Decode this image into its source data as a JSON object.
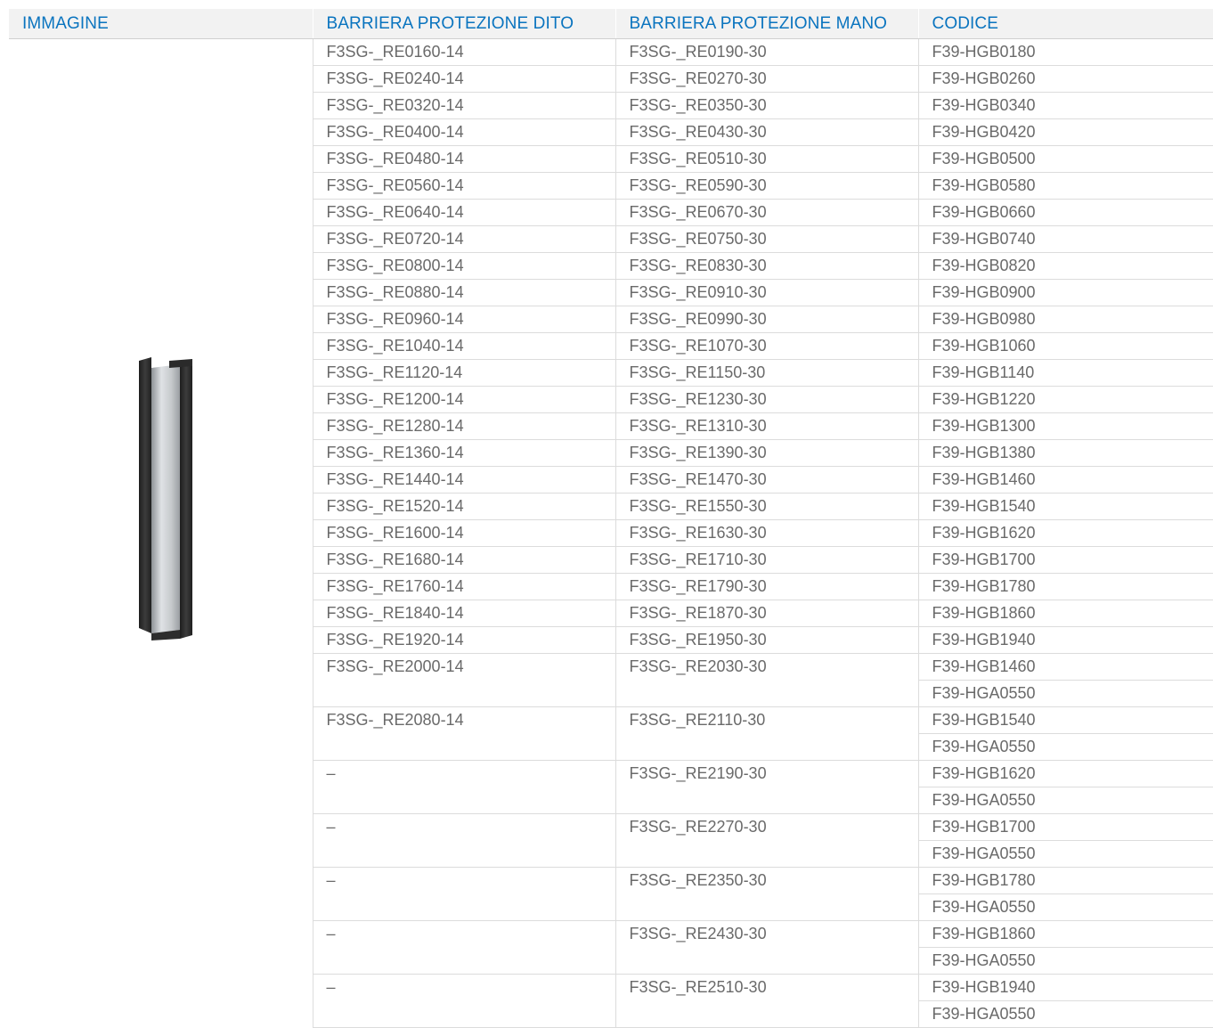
{
  "headers": [
    "IMMAGINE",
    "BARRIERA PROTEZIONE DITO",
    "BARRIERA PROTEZIONE MANO",
    "CODICE"
  ],
  "image": {
    "icon": "profile-bracket-image"
  },
  "rows": [
    {
      "finger": "F3SG-_RE0160-14",
      "hand": "F3SG-_RE0190-30",
      "codes": [
        "F39-HGB0180"
      ]
    },
    {
      "finger": "F3SG-_RE0240-14",
      "hand": "F3SG-_RE0270-30",
      "codes": [
        "F39-HGB0260"
      ]
    },
    {
      "finger": "F3SG-_RE0320-14",
      "hand": "F3SG-_RE0350-30",
      "codes": [
        "F39-HGB0340"
      ]
    },
    {
      "finger": "F3SG-_RE0400-14",
      "hand": "F3SG-_RE0430-30",
      "codes": [
        "F39-HGB0420"
      ]
    },
    {
      "finger": "F3SG-_RE0480-14",
      "hand": "F3SG-_RE0510-30",
      "codes": [
        "F39-HGB0500"
      ]
    },
    {
      "finger": "F3SG-_RE0560-14",
      "hand": "F3SG-_RE0590-30",
      "codes": [
        "F39-HGB0580"
      ]
    },
    {
      "finger": "F3SG-_RE0640-14",
      "hand": "F3SG-_RE0670-30",
      "codes": [
        "F39-HGB0660"
      ]
    },
    {
      "finger": "F3SG-_RE0720-14",
      "hand": "F3SG-_RE0750-30",
      "codes": [
        "F39-HGB0740"
      ]
    },
    {
      "finger": "F3SG-_RE0800-14",
      "hand": "F3SG-_RE0830-30",
      "codes": [
        "F39-HGB0820"
      ]
    },
    {
      "finger": "F3SG-_RE0880-14",
      "hand": "F3SG-_RE0910-30",
      "codes": [
        "F39-HGB0900"
      ]
    },
    {
      "finger": "F3SG-_RE0960-14",
      "hand": "F3SG-_RE0990-30",
      "codes": [
        "F39-HGB0980"
      ]
    },
    {
      "finger": "F3SG-_RE1040-14",
      "hand": "F3SG-_RE1070-30",
      "codes": [
        "F39-HGB1060"
      ]
    },
    {
      "finger": "F3SG-_RE1120-14",
      "hand": "F3SG-_RE1150-30",
      "codes": [
        "F39-HGB1140"
      ]
    },
    {
      "finger": "F3SG-_RE1200-14",
      "hand": "F3SG-_RE1230-30",
      "codes": [
        "F39-HGB1220"
      ]
    },
    {
      "finger": "F3SG-_RE1280-14",
      "hand": "F3SG-_RE1310-30",
      "codes": [
        "F39-HGB1300"
      ]
    },
    {
      "finger": "F3SG-_RE1360-14",
      "hand": "F3SG-_RE1390-30",
      "codes": [
        "F39-HGB1380"
      ]
    },
    {
      "finger": "F3SG-_RE1440-14",
      "hand": "F3SG-_RE1470-30",
      "codes": [
        "F39-HGB1460"
      ]
    },
    {
      "finger": "F3SG-_RE1520-14",
      "hand": "F3SG-_RE1550-30",
      "codes": [
        "F39-HGB1540"
      ]
    },
    {
      "finger": "F3SG-_RE1600-14",
      "hand": "F3SG-_RE1630-30",
      "codes": [
        "F39-HGB1620"
      ]
    },
    {
      "finger": "F3SG-_RE1680-14",
      "hand": "F3SG-_RE1710-30",
      "codes": [
        "F39-HGB1700"
      ]
    },
    {
      "finger": "F3SG-_RE1760-14",
      "hand": "F3SG-_RE1790-30",
      "codes": [
        "F39-HGB1780"
      ]
    },
    {
      "finger": "F3SG-_RE1840-14",
      "hand": "F3SG-_RE1870-30",
      "codes": [
        "F39-HGB1860"
      ]
    },
    {
      "finger": "F3SG-_RE1920-14",
      "hand": "F3SG-_RE1950-30",
      "codes": [
        "F39-HGB1940"
      ]
    },
    {
      "finger": "F3SG-_RE2000-14",
      "hand": "F3SG-_RE2030-30",
      "codes": [
        "F39-HGB1460",
        "F39-HGA0550"
      ]
    },
    {
      "finger": "F3SG-_RE2080-14",
      "hand": "F3SG-_RE2110-30",
      "codes": [
        "F39-HGB1540",
        "F39-HGA0550"
      ]
    },
    {
      "finger": "–",
      "hand": "F3SG-_RE2190-30",
      "codes": [
        "F39-HGB1620",
        "F39-HGA0550"
      ]
    },
    {
      "finger": "–",
      "hand": "F3SG-_RE2270-30",
      "codes": [
        "F39-HGB1700",
        "F39-HGA0550"
      ]
    },
    {
      "finger": "–",
      "hand": "F3SG-_RE2350-30",
      "codes": [
        "F39-HGB1780",
        "F39-HGA0550"
      ]
    },
    {
      "finger": "–",
      "hand": "F3SG-_RE2430-30",
      "codes": [
        "F39-HGB1860",
        "F39-HGA0550"
      ]
    },
    {
      "finger": "–",
      "hand": "F3SG-_RE2510-30",
      "codes": [
        "F39-HGB1940",
        "F39-HGA0550"
      ]
    }
  ]
}
